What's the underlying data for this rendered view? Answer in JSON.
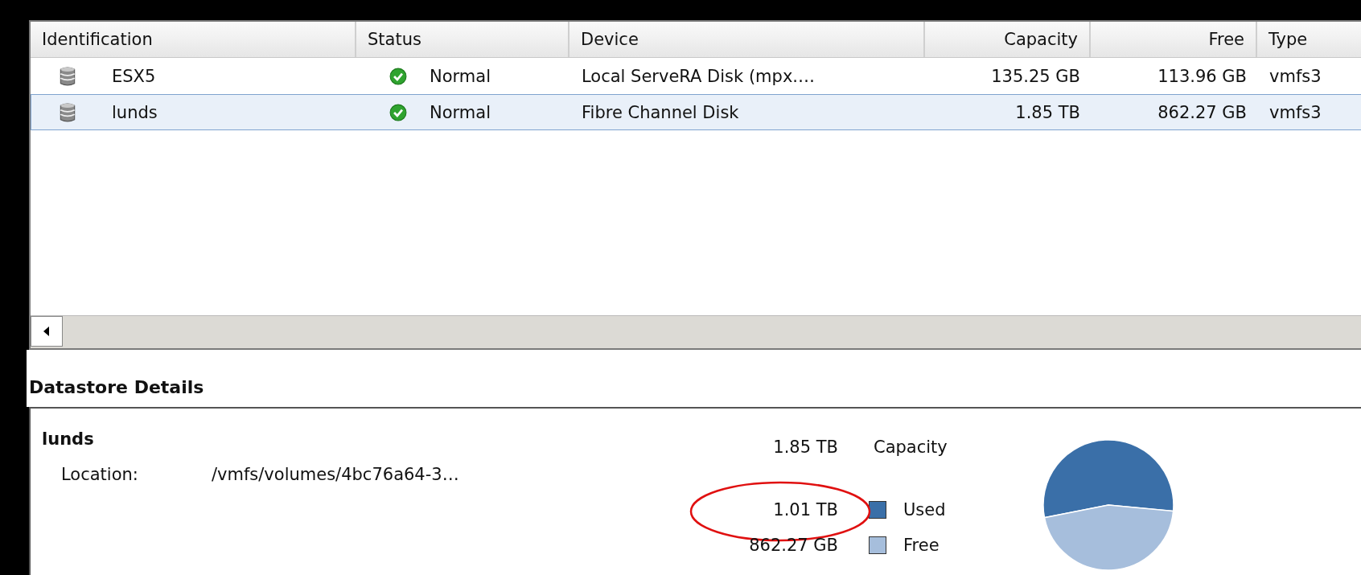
{
  "datastores": {
    "columns": [
      "Identification",
      "Status",
      "Device",
      "Capacity",
      "Free",
      "Type"
    ],
    "rows": [
      {
        "identification": "ESX5",
        "status": "Normal",
        "device": "Local ServeRA Disk (mpx.…",
        "capacity": "135.25 GB",
        "free": "113.96 GB",
        "type": "vmfs3",
        "selected": false
      },
      {
        "identification": "lunds",
        "status": "Normal",
        "device": "Fibre Channel Disk",
        "capacity": "1.85 TB",
        "free": "862.27 GB",
        "type": "vmfs3",
        "selected": true
      }
    ]
  },
  "details": {
    "title": "Datastore Details",
    "name": "lunds",
    "location_label": "Location:",
    "location": "/vmfs/volumes/4bc76a64-3…",
    "legend": [
      {
        "kind": "total",
        "value": "1.85 TB",
        "label": "Capacity",
        "circled": false
      },
      {
        "kind": "swatch",
        "value": "1.01 TB",
        "label": "Used",
        "color": "#3a6fa8",
        "circled": true
      },
      {
        "kind": "swatch",
        "value": "862.27 GB",
        "label": "Free",
        "color": "#a6bedc",
        "circled": false
      }
    ],
    "chart_data": {
      "type": "pie",
      "values": [
        54.6,
        45.4
      ]
    }
  }
}
